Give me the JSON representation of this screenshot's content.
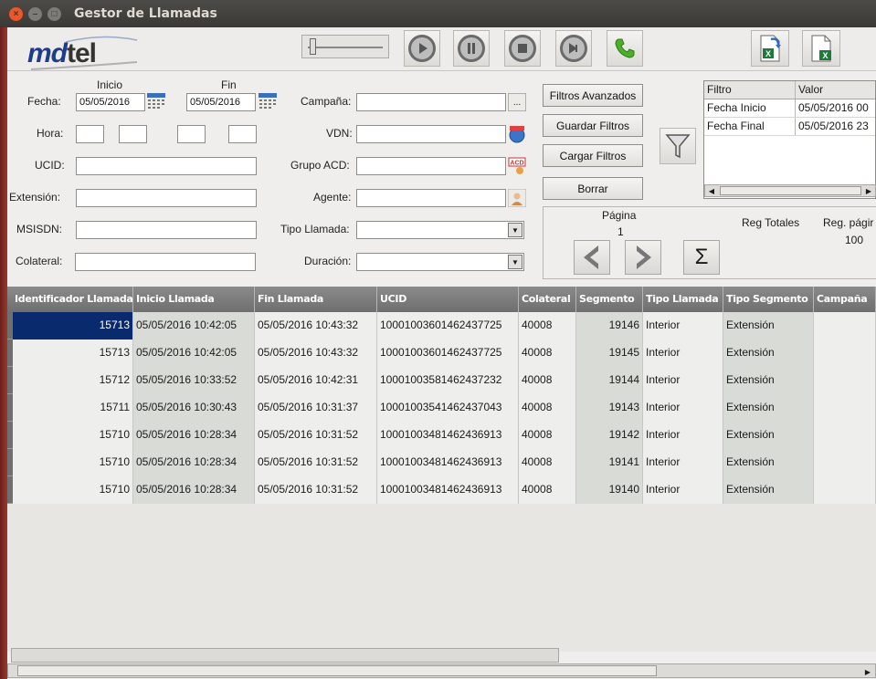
{
  "window": {
    "title": "Gestor de Llamadas"
  },
  "logo": {
    "text_a": "md",
    "text_b": "tel"
  },
  "form": {
    "inicio_label": "Inicio",
    "fin_label": "Fin",
    "fecha_label": "Fecha:",
    "fecha_inicio": "05/05/2016",
    "fecha_fin": "05/05/2016",
    "hora_label": "Hora:",
    "ucid_label": "UCID:",
    "extension_label": "Extensión:",
    "msisdn_label": "MSISDN:",
    "colateral_label": "Colateral:",
    "campana_label": "Campaña:",
    "campana_button": "...",
    "vdn_label": "VDN:",
    "grupo_label": "Grupo ACD:",
    "agente_label": "Agente:",
    "tipo_label": "Tipo Llamada:",
    "duracion_label": "Duración:"
  },
  "actions": {
    "filtros_avanzados": "Filtros Avanzados",
    "guardar_filtros": "Guardar Filtros",
    "cargar_filtros": "Cargar Filtros",
    "borrar": "Borrar"
  },
  "filters": {
    "headers": [
      "Filtro",
      "Valor"
    ],
    "rows": [
      [
        "Fecha Inicio",
        "05/05/2016 00"
      ],
      [
        "Fecha Final",
        "05/05/2016 23"
      ]
    ]
  },
  "pager": {
    "pagina_label": "Página",
    "pagina_value": "1",
    "reg_totales_label": "Reg Totales",
    "reg_pagina_label": "Reg. págir",
    "reg_pagina_value": "100",
    "sum_symbol": "Σ"
  },
  "table": {
    "headers": [
      "Identificador Llamada",
      "Inicio Llamada",
      "Fin Llamada",
      "UCID",
      "Colateral",
      "Segmento",
      "Tipo Llamada",
      "Tipo Segmento",
      "Campaña"
    ],
    "rows": [
      [
        "15713",
        "05/05/2016 10:42:05",
        "05/05/2016 10:43:32",
        "10001003601462437725",
        "40008",
        "19146",
        "Interior",
        "Extensión",
        ""
      ],
      [
        "15713",
        "05/05/2016 10:42:05",
        "05/05/2016 10:43:32",
        "10001003601462437725",
        "40008",
        "19145",
        "Interior",
        "Extensión",
        ""
      ],
      [
        "15712",
        "05/05/2016 10:33:52",
        "05/05/2016 10:42:31",
        "10001003581462437232",
        "40008",
        "19144",
        "Interior",
        "Extensión",
        ""
      ],
      [
        "15711",
        "05/05/2016 10:30:43",
        "05/05/2016 10:31:37",
        "10001003541462437043",
        "40008",
        "19143",
        "Interior",
        "Extensión",
        ""
      ],
      [
        "15710",
        "05/05/2016 10:28:34",
        "05/05/2016 10:31:52",
        "10001003481462436913",
        "40008",
        "19142",
        "Interior",
        "Extensión",
        ""
      ],
      [
        "15710",
        "05/05/2016 10:28:34",
        "05/05/2016 10:31:52",
        "10001003481462436913",
        "40008",
        "19141",
        "Interior",
        "Extensión",
        ""
      ],
      [
        "15710",
        "05/05/2016 10:28:34",
        "05/05/2016 10:31:52",
        "10001003481462436913",
        "40008",
        "19140",
        "Interior",
        "Extensión",
        ""
      ]
    ]
  },
  "colors": {
    "selected_cell": "#0a2a6e",
    "header_bg": "#7a7a7a",
    "shaded_col": "#d9dbd6"
  },
  "icons": [
    "close-icon",
    "minimize-icon",
    "maximize-icon",
    "play-icon",
    "pause-icon",
    "stop-icon",
    "record-icon",
    "phone-icon",
    "excel-export-icon",
    "excel-icon",
    "calendar-icon",
    "vdn-icon",
    "acd-icon",
    "agent-icon",
    "funnel-icon",
    "prev-page-icon",
    "next-page-icon"
  ]
}
